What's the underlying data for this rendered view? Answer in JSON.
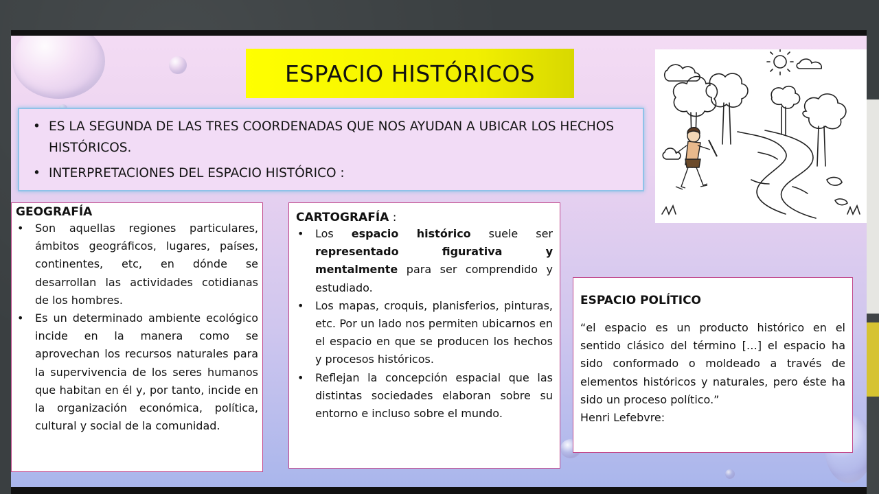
{
  "title": "ESPACIO HISTÓRICOS",
  "intro": [
    "ES LA SEGUNDA DE LAS TRES COORDENADAS QUE NOS AYUDAN A UBICAR LOS HECHOS HISTÓRICOS.",
    "INTERPRETACIONES DEL ESPACIO HISTÓRICO :"
  ],
  "bullet": "•",
  "geografia": {
    "heading": "GEOGRAFÍA",
    "items": [
      "Son aquellas regiones particulares, ámbitos geográficos, lugares, países, continentes, etc, en dónde se desarrollan las actividades cotidianas de los hombres.",
      "Es un determinado ambiente ecológico incide en la manera como se aprovechan los recursos naturales para la supervivencia de los seres humanos que habitan en él y, por tanto, incide en la organización económica, política, cultural y social de la comunidad."
    ]
  },
  "cartografia": {
    "heading": "CARTOGRAFÍA",
    "heading_suffix": " :",
    "item1": {
      "t1": "Los ",
      "b1": "espacio histórico",
      "t2": " suele ser ",
      "b2": "representado figurativa y mentalmente",
      "t3": " para ser comprendido y estudiado."
    },
    "items": [
      "Los mapas, croquis, planisferios, pinturas, etc. Por un lado nos permiten ubicarnos en el espacio en que se producen los hechos y procesos históricos.",
      "Reflejan la concepción espacial que las distintas sociedades elaboran sobre su entorno e incluso sobre el mundo."
    ]
  },
  "politico": {
    "heading": "ESPACIO POLÍTICO",
    "quote": "“el espacio es un producto histórico en el sentido clásico del término […] el espacio ha sido conformado o moldeado a través de elementos históricos y naturales, pero éste ha sido un proceso político.”",
    "author": "Henri Lefebvre:"
  },
  "illustration": "caveman-landscape-drawing"
}
